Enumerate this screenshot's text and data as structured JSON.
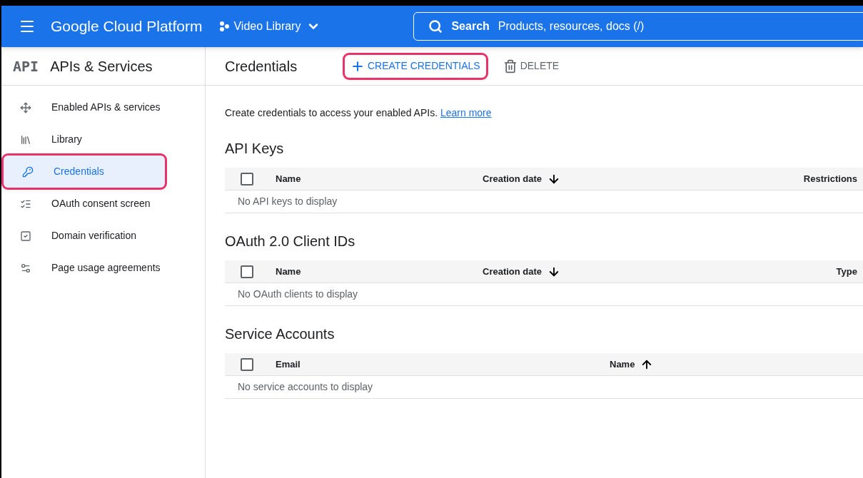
{
  "header": {
    "title": "Google Cloud Platform",
    "project": "Video Library",
    "search": {
      "label": "Search",
      "placeholder": "Products, resources, docs (/)"
    }
  },
  "sidebar": {
    "badge": "API",
    "title": "APIs & Services",
    "items": [
      {
        "label": "Enabled APIs & services",
        "selected": false,
        "highlighted": false
      },
      {
        "label": "Library",
        "selected": false,
        "highlighted": false
      },
      {
        "label": "Credentials",
        "selected": true,
        "highlighted": true
      },
      {
        "label": "OAuth consent screen",
        "selected": false,
        "highlighted": false
      },
      {
        "label": "Domain verification",
        "selected": false,
        "highlighted": false
      },
      {
        "label": "Page usage agreements",
        "selected": false,
        "highlighted": false
      }
    ]
  },
  "page": {
    "title": "Credentials",
    "actions": [
      {
        "label": "CREATE CREDENTIALS",
        "kind": "create",
        "highlighted": true,
        "disabled": false
      },
      {
        "label": "DELETE",
        "kind": "delete",
        "highlighted": false,
        "disabled": true
      }
    ],
    "intro": "Create credentials to access your enabled APIs.",
    "link": "Learn more",
    "sections": [
      {
        "title": "API Keys",
        "checked": false,
        "columns": [
          {
            "label": "Name",
            "kind": "plain"
          },
          {
            "label": "Creation date",
            "kind": "descending"
          },
          {
            "label": "Restrictions",
            "kind": "plain"
          }
        ],
        "empty": "No API keys to display"
      },
      {
        "title": "OAuth 2.0 Client IDs",
        "checked": false,
        "columns": [
          {
            "label": "Name",
            "kind": "plain"
          },
          {
            "label": "Creation date",
            "kind": "descending"
          },
          {
            "label": "Type",
            "kind": "plain"
          }
        ],
        "empty": "No OAuth clients to display"
      },
      {
        "title": "Service Accounts",
        "checked": false,
        "columns": [
          {
            "label": "Email",
            "kind": "plain"
          },
          {
            "label": "Name",
            "kind": "ascending"
          }
        ],
        "empty": "No service accounts to display"
      }
    ]
  }
}
